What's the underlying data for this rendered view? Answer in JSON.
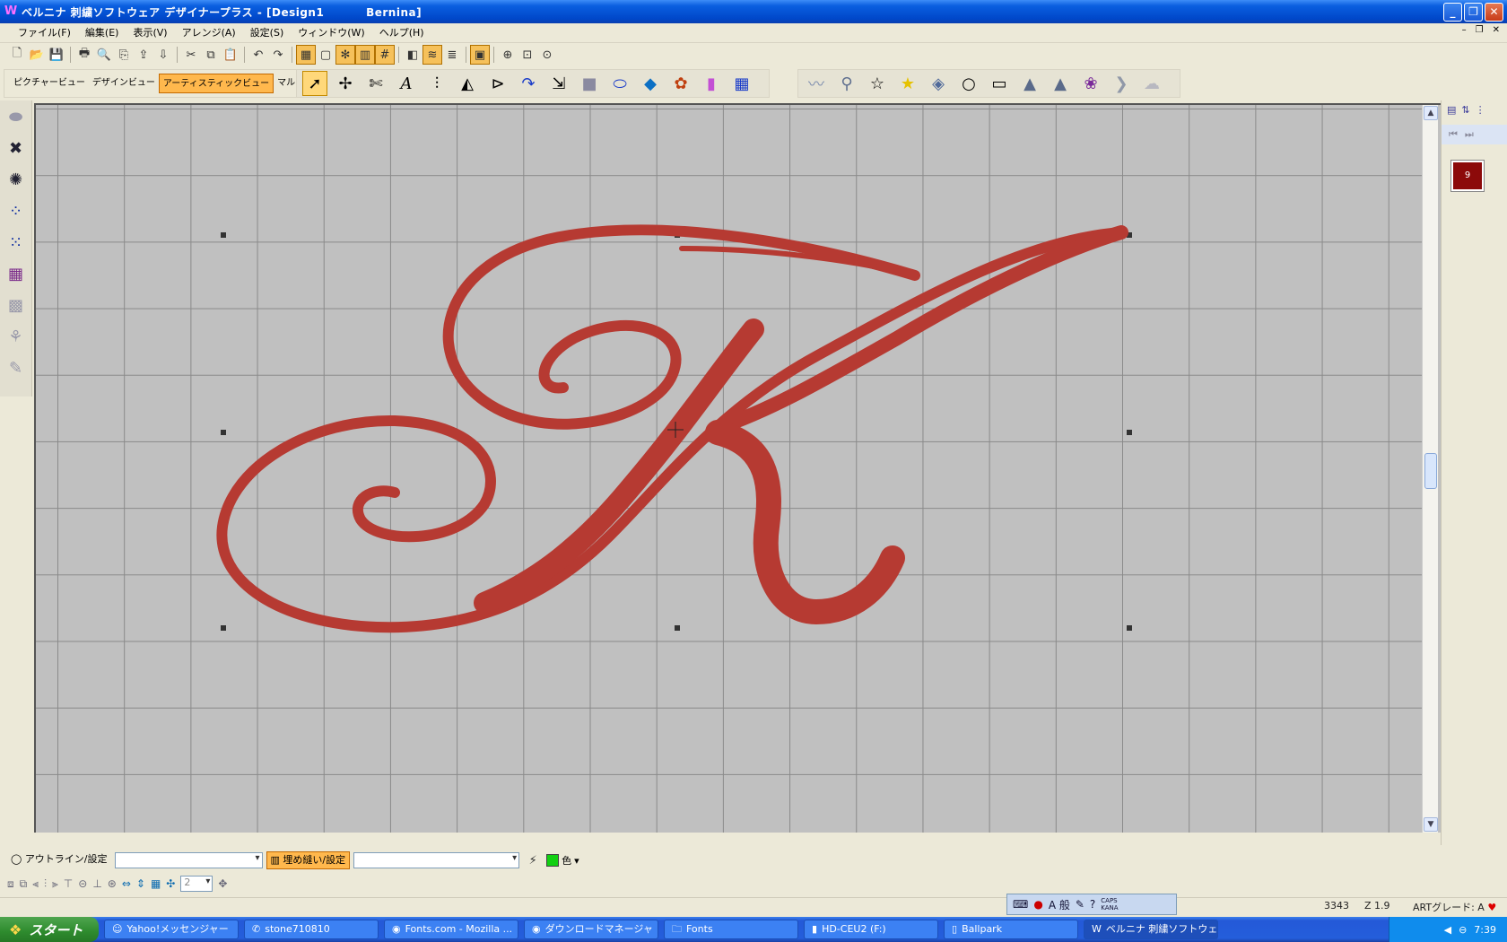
{
  "window": {
    "title": "ベルニナ 刺繍ソフトウェア デザイナープラス - [Design1          Bernina]"
  },
  "menu": [
    "ファイル(F)",
    "編集(E)",
    "表示(V)",
    "アレンジ(A)",
    "設定(S)",
    "ウィンドウ(W)",
    "ヘルプ(H)"
  ],
  "views": [
    "ピクチャービュー",
    "デザインビュー",
    "アーティスティックビュー",
    "マルチ刺繍枠表示"
  ],
  "active_view": "アーティスティックビュー",
  "color_chip": {
    "label": "9",
    "color": "#8c0a0a"
  },
  "design": {
    "letter": "K",
    "thread_color": "#b63a32"
  },
  "bottom_toolbar": {
    "outline_label": "アウトライン/設定",
    "fill_label": "埋め縫い/設定",
    "color_label": "色",
    "color": "#12d012",
    "spin_value": "2"
  },
  "status": {
    "stitches": "3343",
    "zoom": "Z 1.9",
    "art_grade": "ARTグレード: A",
    "caps": "CAPS",
    "kana": "KANA"
  },
  "taskbar": {
    "start": "スタート",
    "tasks": [
      "Yahoo!メッセンジャー",
      "stone710810",
      "Fonts.com - Mozilla ...",
      "ダウンロードマネージャ",
      "Fonts",
      "HD-CEU2 (F:)",
      "Ballpark",
      "ベルニナ 刺繍ソフトウェア ..."
    ],
    "clock": "7:39"
  }
}
